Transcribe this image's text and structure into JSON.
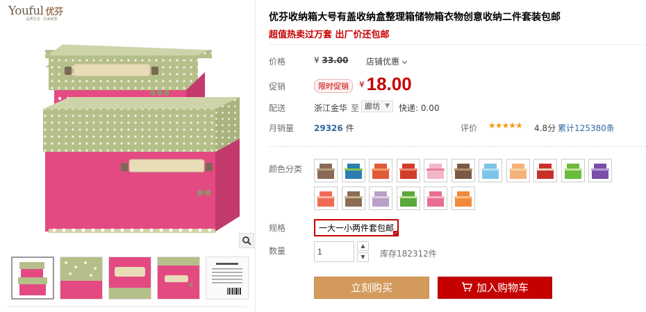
{
  "logo": {
    "brand": "Youful",
    "brand_cn": "优芬",
    "tagline": "·品质生活· ·优美家居·"
  },
  "product": {
    "title": "优芬收纳箱大号有盖收纳盒整理箱储物箱衣物创意收纳二件套装包邮",
    "subtitle": "超值热卖过万套 出厂价还包邮"
  },
  "price": {
    "label": "价格",
    "currency": "¥",
    "original": "33.00",
    "shop_promo": "店铺优惠"
  },
  "promo": {
    "label": "促销",
    "badge": "限时促销",
    "currency": "¥",
    "amount": "18.00"
  },
  "shipping": {
    "label": "配送",
    "from": "浙江金华",
    "to_label": "至",
    "destination": "廊坊",
    "fee": "快递: 0.00"
  },
  "sales": {
    "label": "月销量",
    "count": "29326",
    "unit": "件"
  },
  "rating": {
    "label": "评价",
    "stars": "★★★★★",
    "score": "4.8分",
    "total": "累计125380条"
  },
  "color": {
    "label": "颜色分类",
    "swatches": [
      {
        "name": "coffee",
        "c1": "#8a6a55",
        "c2": "#b5a07a"
      },
      {
        "name": "blue-green",
        "c1": "#2a7fb0",
        "c2": "#8bc34a"
      },
      {
        "name": "orange-red",
        "c1": "#e05a3a",
        "c2": "#f39c6b"
      },
      {
        "name": "red",
        "c1": "#d33c2b",
        "c2": "#e88a76"
      },
      {
        "name": "pink-floral",
        "c1": "#f3b6c6",
        "c2": "#e87fa0"
      },
      {
        "name": "brown",
        "c1": "#7a5a45",
        "c2": "#b58e6e"
      },
      {
        "name": "light-blue",
        "c1": "#7ec4e8",
        "c2": "#b6e0f2"
      },
      {
        "name": "peach",
        "c1": "#f4b27a",
        "c2": "#f7d0a5"
      },
      {
        "name": "red-beige",
        "c1": "#c9302c",
        "c2": "#e9d7b8"
      },
      {
        "name": "green",
        "c1": "#6bbb3c",
        "c2": "#bce39b"
      },
      {
        "name": "purple",
        "c1": "#7a4fa8",
        "c2": "#b99ad6"
      },
      {
        "name": "coral",
        "c1": "#f06b55",
        "c2": "#f8b7a7"
      },
      {
        "name": "coffee-dot",
        "c1": "#8b6c52",
        "c2": "#c9b28f"
      },
      {
        "name": "lilac",
        "c1": "#b9a0c8",
        "c2": "#dcd0e4"
      },
      {
        "name": "green-dot",
        "c1": "#5aa83a",
        "c2": "#c2df9f"
      },
      {
        "name": "pink",
        "c1": "#e96d93",
        "c2": "#f6b7ca"
      },
      {
        "name": "orange",
        "c1": "#f08a3a",
        "c2": "#f7c28c"
      }
    ]
  },
  "spec": {
    "label": "规格",
    "selected": "一大一小两件套包邮"
  },
  "quantity": {
    "label": "数量",
    "value": "1",
    "stock": "库存182312件"
  },
  "actions": {
    "buy": "立刻购买",
    "cart": "加入购物车"
  },
  "colors": {
    "accent_red": "#c40000",
    "buy_button": "#d39a5b",
    "link_blue": "#2c6aa0",
    "star": "#f39c12",
    "product_pink": "#e0487f",
    "product_lid": "#b5bf8a"
  }
}
